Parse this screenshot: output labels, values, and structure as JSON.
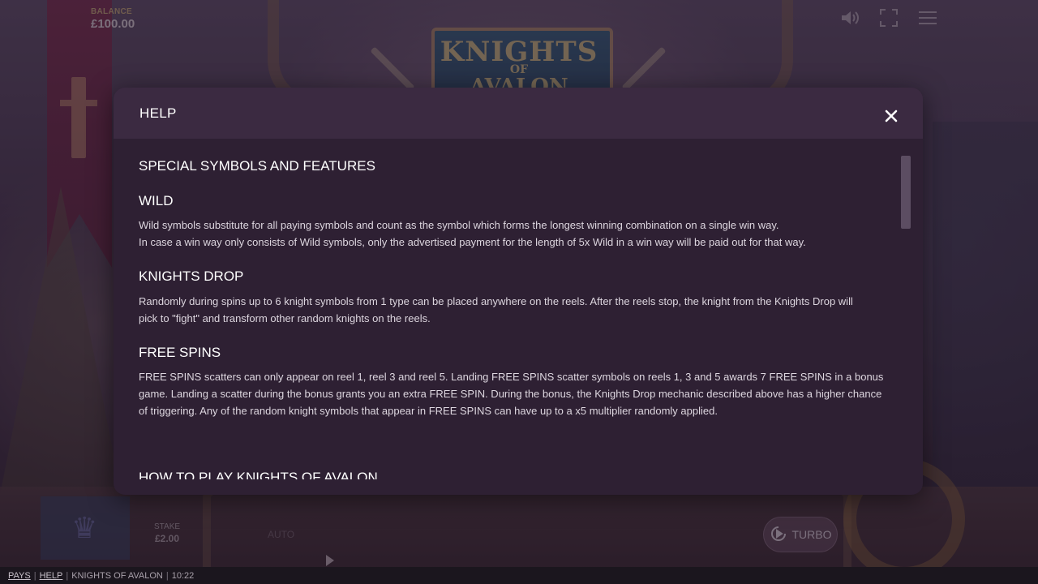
{
  "game": {
    "logo_line1": "KNIGHTS",
    "logo_line2": "OF",
    "logo_line3": "AVALON"
  },
  "hud": {
    "balance_label": "BALANCE",
    "balance_value": "£100.00",
    "icons": [
      "speaker-icon",
      "fullscreen-icon",
      "menu-icon"
    ],
    "stake_label": "STAKE",
    "stake_value": "£2.00",
    "auto_label": "AUTO",
    "turbo_label": "TURBO"
  },
  "status_bar": {
    "pays_link": "PAYS",
    "help_link": "HELP",
    "game_name": "KNIGHTS OF AVALON",
    "time": "10:22"
  },
  "modal": {
    "title": "HELP",
    "section_title": "SPECIAL SYMBOLS AND FEATURES",
    "sections": [
      {
        "heading": "WILD",
        "paragraphs": [
          "Wild symbols substitute for all paying symbols and count as the symbol which forms the longest winning combination on a single win way.",
          "In case a win way only consists of Wild symbols, only the advertised payment for the length of 5x Wild in a win way will be paid out for that way."
        ]
      },
      {
        "heading": "KNIGHTS DROP",
        "paragraphs": [
          "Randomly during spins up to 6 knight symbols from 1 type can be placed anywhere on the reels. After the reels stop, the knight from the Knights Drop will pick to \"fight\" and transform other random knights on the reels."
        ]
      },
      {
        "heading": "FREE SPINS",
        "paragraphs": [
          "FREE SPINS scatters can only appear on reel 1, reel 3 and reel 5. Landing FREE SPINS scatter symbols on reels 1, 3 and 5 awards 7 FREE SPINS in a bonus game. Landing a scatter during the bonus grants you an extra FREE SPIN. During the bonus, the Knights Drop mechanic described above has a higher chance of triggering. Any of the random knight symbols that appear in FREE SPINS can have up to a x5 multiplier randomly applied."
        ]
      }
    ],
    "next_heading": "HOW TO PLAY KNIGHTS OF AVALON"
  },
  "colors": {
    "modal_bg": "#2e2033",
    "modal_header": "#3b2a41",
    "text": "#ddd6df",
    "heading": "#ffffff"
  }
}
